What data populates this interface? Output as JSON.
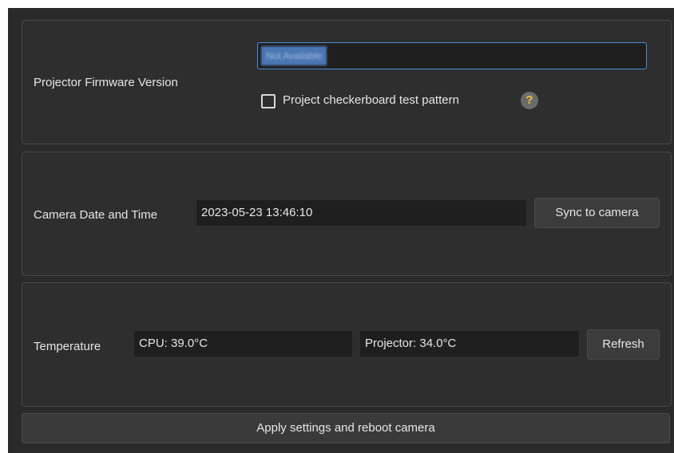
{
  "firmware": {
    "label": "Projector Firmware Version",
    "value": "Not Available",
    "checkbox_label": "Project checkerboard test pattern",
    "checkbox_checked": false,
    "help_glyph": "?"
  },
  "camera_time": {
    "label": "Camera Date and Time",
    "value": "2023-05-23 13:46:10",
    "sync_button": "Sync to camera"
  },
  "temperature": {
    "label": "Temperature",
    "cpu": "CPU: 39.0°C",
    "projector": "Projector: 34.0°C",
    "refresh_button": "Refresh"
  },
  "apply_button": "Apply settings and reboot camera",
  "colors": {
    "background": "#2a2a2a",
    "panel": "#2e2e2e",
    "field": "#1f1f1f",
    "focus_border": "#4a90d9",
    "help_icon": "#f0c040"
  }
}
